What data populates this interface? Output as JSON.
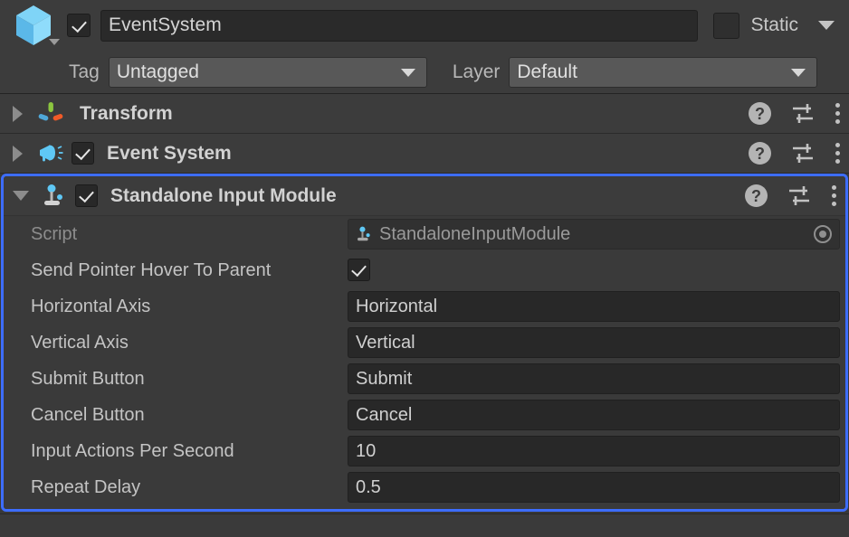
{
  "gameobject": {
    "icon": "cube-icon",
    "enabled": true,
    "name": "EventSystem",
    "static_label": "Static",
    "static_checked": false,
    "tag_label": "Tag",
    "tag_value": "Untagged",
    "layer_label": "Layer",
    "layer_value": "Default"
  },
  "components": [
    {
      "name": "Transform",
      "icon": "transform-gizmo-icon",
      "expanded": false,
      "has_enable_checkbox": false,
      "enabled": false,
      "selected": false
    },
    {
      "name": "Event System",
      "icon": "megaphone-icon",
      "expanded": false,
      "has_enable_checkbox": true,
      "enabled": true,
      "selected": false
    },
    {
      "name": "Standalone Input Module",
      "icon": "joystick-icon",
      "expanded": true,
      "has_enable_checkbox": true,
      "enabled": true,
      "selected": true
    }
  ],
  "tools": {
    "help_label": "?",
    "help_name": "help-icon",
    "preset_name": "preset-sliders-icon",
    "menu_name": "more-options-icon"
  },
  "properties": [
    {
      "label": "Script",
      "value": "StandaloneInputModule",
      "type": "object",
      "disabled": true,
      "icon": "joystick-icon"
    },
    {
      "label": "Send Pointer Hover To Parent",
      "value": "",
      "type": "checkbox",
      "checked": true
    },
    {
      "label": "Horizontal Axis",
      "value": "Horizontal",
      "type": "text"
    },
    {
      "label": "Vertical Axis",
      "value": "Vertical",
      "type": "text"
    },
    {
      "label": "Submit Button",
      "value": "Submit",
      "type": "text"
    },
    {
      "label": "Cancel Button",
      "value": "Cancel",
      "type": "text"
    },
    {
      "label": "Input Actions Per Second",
      "value": "10",
      "type": "text"
    },
    {
      "label": "Repeat Delay",
      "value": "0.5",
      "type": "text"
    }
  ],
  "colors": {
    "selection_blue": "#3d6dff",
    "panel_bg": "#3a3a3a",
    "header_bg": "#3c3c3c",
    "field_bg": "#282828",
    "icon_blue": "#5fc8f5",
    "axis_green": "#8cc63f",
    "axis_blue": "#4fa8d8",
    "axis_orange": "#f05a28"
  }
}
